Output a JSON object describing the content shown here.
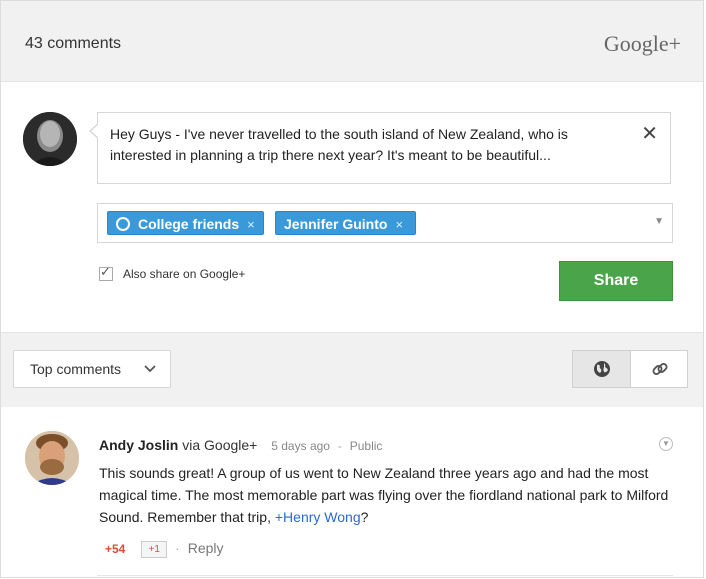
{
  "header": {
    "comment_count": "43 comments",
    "brand": "Google+"
  },
  "compose": {
    "text": "Hey Guys - I've never travelled to the south island of New Zealand, who is interested in planning a trip there next year? It's meant to be beautiful...",
    "recipients": [
      {
        "label": "College friends",
        "remove": "×"
      },
      {
        "label": "Jennifer Guinto",
        "remove": "×"
      }
    ],
    "also_share_label": "Also share on Google+",
    "also_share_checked": true,
    "share_label": "Share",
    "close_glyph": "✕"
  },
  "toolbar": {
    "sort_label": "Top comments"
  },
  "comment": {
    "author": "Andy Joslin",
    "via": "via Google+",
    "time": "5 days ago",
    "visibility": "Public",
    "body_pre": "This sounds great! A group of us went to New Zealand three years ago and had the most magical time. The most memorable part was flying over the fiordland national park to Milford Sound. Remember that trip, ",
    "mention": "+Henry Wong",
    "body_post": "?",
    "plus_count": "+54",
    "plus_label": "+1",
    "reply_label": "Reply"
  },
  "colors": {
    "share_button": "#4aa54a",
    "chip": "#3a9ad9",
    "mention": "#2a6acf",
    "plus_red": "#dd4b39"
  }
}
